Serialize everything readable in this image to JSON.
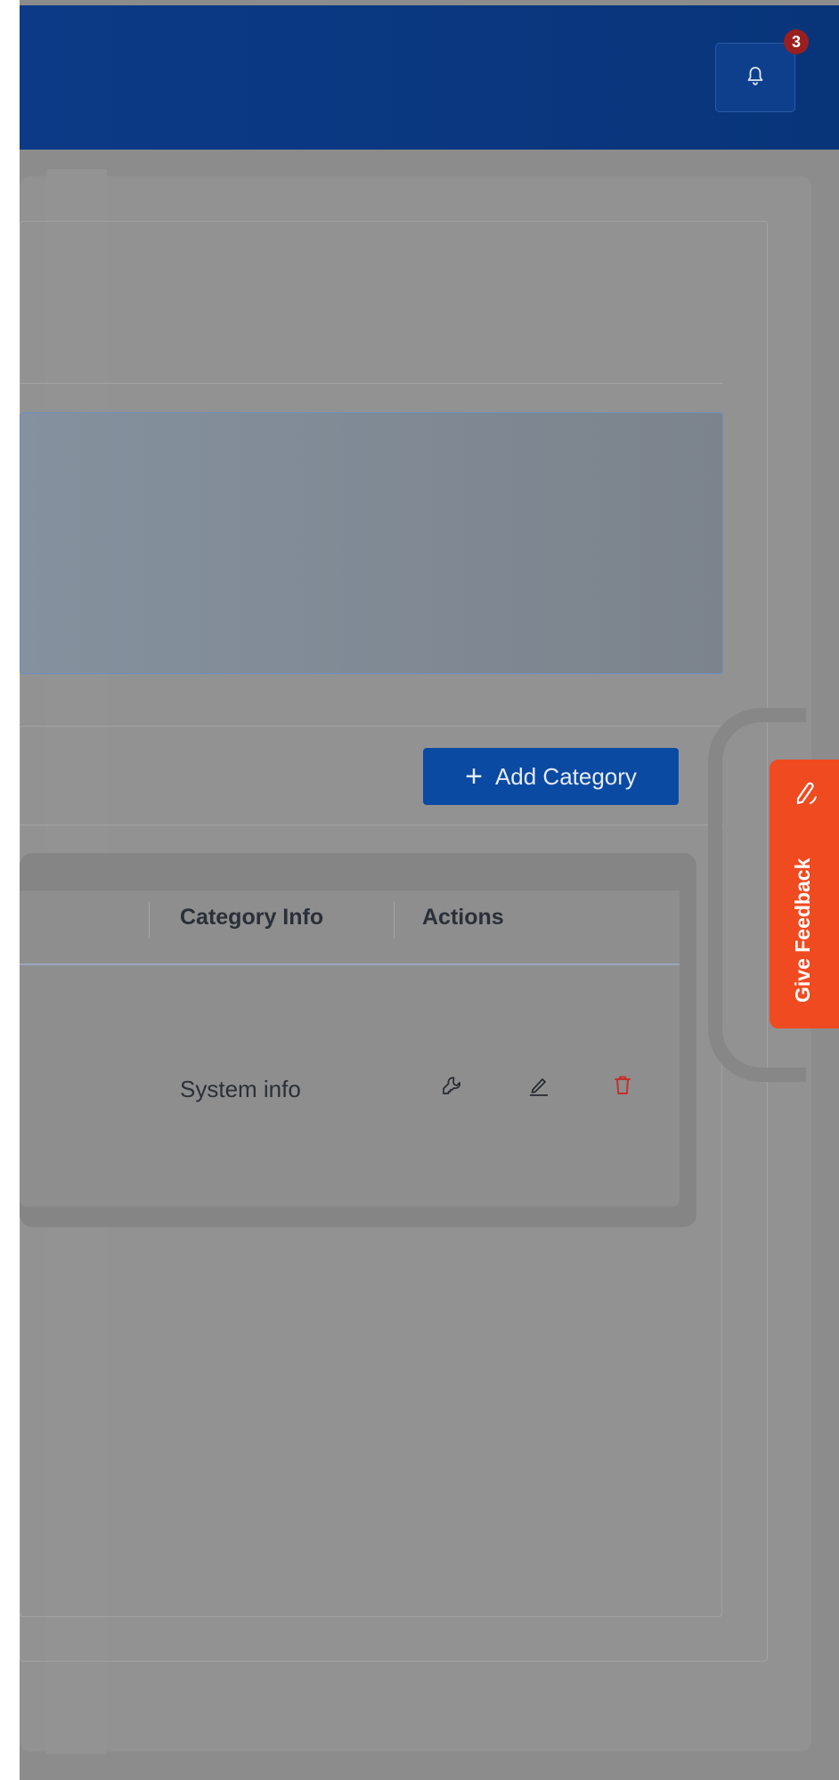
{
  "header": {
    "notifications_count": "3"
  },
  "toolbar": {
    "add_category_label": "Add Category"
  },
  "table": {
    "columns": [
      "Category Info",
      "Actions"
    ],
    "rows": [
      {
        "category_info": "System info"
      }
    ]
  },
  "feedback": {
    "label": "Give Feedback",
    "color": "#f04a20"
  },
  "colors": {
    "header": "#0c3a86",
    "primary_button": "#0b4aa2",
    "delete": "#c4302b"
  },
  "icons": [
    "bell-icon",
    "plus-icon",
    "wrench-icon",
    "edit-icon",
    "trash-icon",
    "pen-icon"
  ]
}
